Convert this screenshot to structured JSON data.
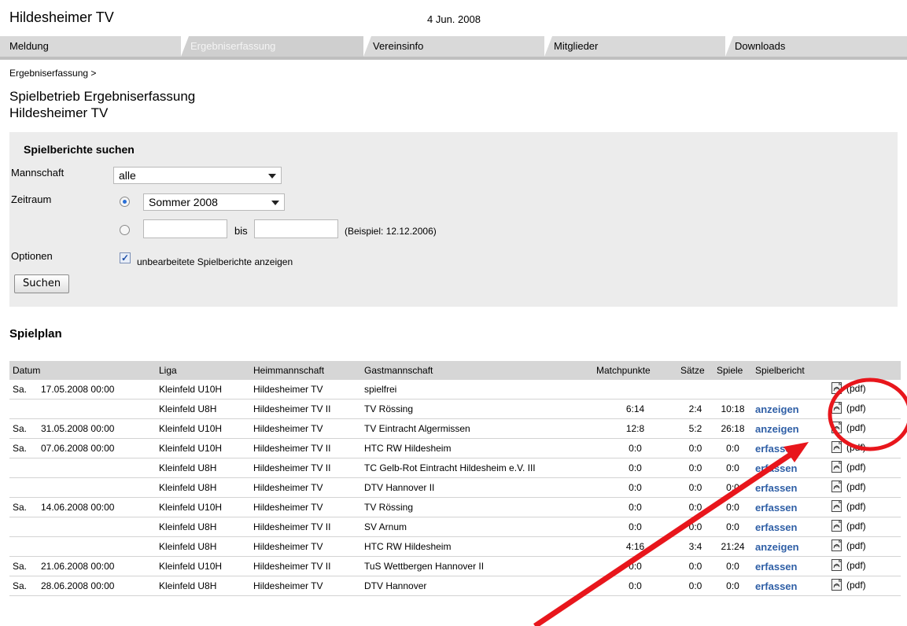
{
  "header": {
    "club": "Hildesheimer TV",
    "date": "4 Jun. 2008"
  },
  "tabs": [
    "Meldung",
    "Ergebniserfassung",
    "Vereinsinfo",
    "Mitglieder",
    "Downloads"
  ],
  "breadcrumb": "Ergebniserfassung >",
  "page_title": {
    "line1": "Spielbetrieb Ergebniserfassung",
    "line2": "Hildesheimer TV"
  },
  "search": {
    "title": "Spielberichte suchen",
    "mannschaft_label": "Mannschaft",
    "mannschaft_value": "alle",
    "zeitraum_label": "Zeitraum",
    "zeitraum_value": "Sommer 2008",
    "bis": "bis",
    "beispiel": "(Beispiel: 12.12.2006)",
    "optionen_label": "Optionen",
    "option_text": "unbearbeitete Spielberichte anzeigen",
    "button": "Suchen"
  },
  "spielplan": {
    "title": "Spielplan",
    "columns": [
      "Datum",
      "Liga",
      "Heimmannschaft",
      "Gastmannschaft",
      "Matchpunkte",
      "Sätze",
      "Spiele",
      "Spielbericht",
      ""
    ],
    "pdf_label": "(pdf)",
    "rows": [
      {
        "day": "Sa.",
        "date": "17.05.2008 00:00",
        "liga": "Kleinfeld U10H",
        "heim": "Hildesheimer TV",
        "gast": "spielfrei",
        "mp": "",
        "saetze": "",
        "spiele": "",
        "bericht": ""
      },
      {
        "day": "",
        "date": "",
        "liga": "Kleinfeld U8H",
        "heim": "Hildesheimer TV II",
        "gast": "TV Rössing",
        "mp": "6:14",
        "saetze": "2:4",
        "spiele": "10:18",
        "bericht": "anzeigen"
      },
      {
        "day": "Sa.",
        "date": "31.05.2008 00:00",
        "liga": "Kleinfeld U10H",
        "heim": "Hildesheimer TV",
        "gast": "TV Eintracht Algermissen",
        "mp": "12:8",
        "saetze": "5:2",
        "spiele": "26:18",
        "bericht": "anzeigen"
      },
      {
        "day": "Sa.",
        "date": "07.06.2008 00:00",
        "liga": "Kleinfeld U10H",
        "heim": "Hildesheimer TV II",
        "gast": "HTC RW Hildesheim",
        "mp": "0:0",
        "saetze": "0:0",
        "spiele": "0:0",
        "bericht": "erfassen"
      },
      {
        "day": "",
        "date": "",
        "liga": "Kleinfeld U8H",
        "heim": "Hildesheimer TV II",
        "gast": "TC Gelb-Rot Eintracht Hildesheim e.V. III",
        "mp": "0:0",
        "saetze": "0:0",
        "spiele": "0:0",
        "bericht": "erfassen"
      },
      {
        "day": "",
        "date": "",
        "liga": "Kleinfeld U8H",
        "heim": "Hildesheimer TV",
        "gast": "DTV Hannover II",
        "mp": "0:0",
        "saetze": "0:0",
        "spiele": "0:0",
        "bericht": "erfassen"
      },
      {
        "day": "Sa.",
        "date": "14.06.2008 00:00",
        "liga": "Kleinfeld U10H",
        "heim": "Hildesheimer TV",
        "gast": "TV Rössing",
        "mp": "0:0",
        "saetze": "0:0",
        "spiele": "0:0",
        "bericht": "erfassen"
      },
      {
        "day": "",
        "date": "",
        "liga": "Kleinfeld U8H",
        "heim": "Hildesheimer TV II",
        "gast": "SV Arnum",
        "mp": "0:0",
        "saetze": "0:0",
        "spiele": "0:0",
        "bericht": "erfassen"
      },
      {
        "day": "",
        "date": "",
        "liga": "Kleinfeld U8H",
        "heim": "Hildesheimer TV",
        "gast": "HTC RW Hildesheim",
        "mp": "4:16",
        "saetze": "3:4",
        "spiele": "21:24",
        "bericht": "anzeigen"
      },
      {
        "day": "Sa.",
        "date": "21.06.2008 00:00",
        "liga": "Kleinfeld U10H",
        "heim": "Hildesheimer TV II",
        "gast": "TuS Wettbergen Hannover II",
        "mp": "0:0",
        "saetze": "0:0",
        "spiele": "0:0",
        "bericht": "erfassen"
      },
      {
        "day": "Sa.",
        "date": "28.06.2008 00:00",
        "liga": "Kleinfeld U8H",
        "heim": "Hildesheimer TV",
        "gast": "DTV Hannover",
        "mp": "0:0",
        "saetze": "0:0",
        "spiele": "0:0",
        "bericht": "erfassen"
      }
    ]
  },
  "colors": {
    "link": "#2f5fa6",
    "annotation": "#e8161c",
    "tabbar": "#d9d9d9"
  },
  "icons": {
    "pdf": "pdf-file-icon"
  }
}
